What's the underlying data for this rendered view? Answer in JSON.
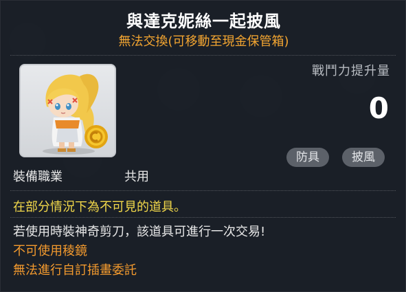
{
  "item": {
    "name": "與達克妮絲一起披風",
    "trade_note": "無法交換(可移動至現金保管箱)"
  },
  "combat_power": {
    "label": "戰鬥力提升量",
    "value": "0"
  },
  "tags": [
    "防具",
    "披風"
  ],
  "job": {
    "label": "裝備職業",
    "value": "共用"
  },
  "description": {
    "hidden_note": "在部分情況下為不可見的道具。",
    "scissors_note": "若使用時裝神奇剪刀，該道具可進行一次交易!",
    "prism_note": "不可使用稜鏡",
    "custom_note": "無法進行自訂插畫委託"
  },
  "colors": {
    "title": "#ffffff",
    "trade_note": "#f3a531",
    "hidden_note": "#f2d84a",
    "restriction": "#f39a2e",
    "tag_bg": "#5c6169"
  }
}
